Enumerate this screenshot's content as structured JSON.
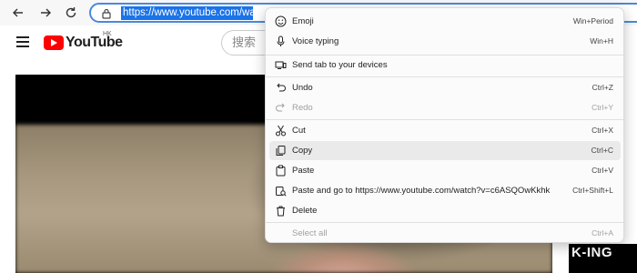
{
  "browser": {
    "url_selected_text": "https://www.youtube.com/watch?v=c6ASQ..."
  },
  "youtube": {
    "logo_text": "YouTube",
    "region": "HK",
    "search_placeholder": "搜索"
  },
  "video": {
    "watermark": "K-ING"
  },
  "context_menu": {
    "items": [
      {
        "label": "Emoji",
        "shortcut": "Win+Period",
        "icon": "emoji-icon"
      },
      {
        "label": "Voice typing",
        "shortcut": "Win+H",
        "icon": "microphone-icon"
      },
      {
        "label": "Send tab to your devices",
        "shortcut": "",
        "icon": "devices-icon"
      },
      {
        "label": "Undo",
        "shortcut": "Ctrl+Z",
        "icon": "undo-icon"
      },
      {
        "label": "Redo",
        "shortcut": "Ctrl+Y",
        "icon": "redo-icon"
      },
      {
        "label": "Cut",
        "shortcut": "Ctrl+X",
        "icon": "scissors-icon"
      },
      {
        "label": "Copy",
        "shortcut": "Ctrl+C",
        "icon": "copy-icon"
      },
      {
        "label": "Paste",
        "shortcut": "Ctrl+V",
        "icon": "paste-icon"
      },
      {
        "label": "Paste and go to https://www.youtube.com/watch?v=c6ASQOwKkhk",
        "shortcut": "Ctrl+Shift+L",
        "icon": "paste-go-icon"
      },
      {
        "label": "Delete",
        "shortcut": "",
        "icon": "trash-icon"
      },
      {
        "label": "Select all",
        "shortcut": "Ctrl+A",
        "icon": ""
      }
    ]
  },
  "colors": {
    "selection": "#1a73e8",
    "address_border": "#4a89dc",
    "youtube_red": "#ff0000",
    "menu_highlight": "#eaeaea",
    "disabled_text": "#a0a0a0"
  }
}
